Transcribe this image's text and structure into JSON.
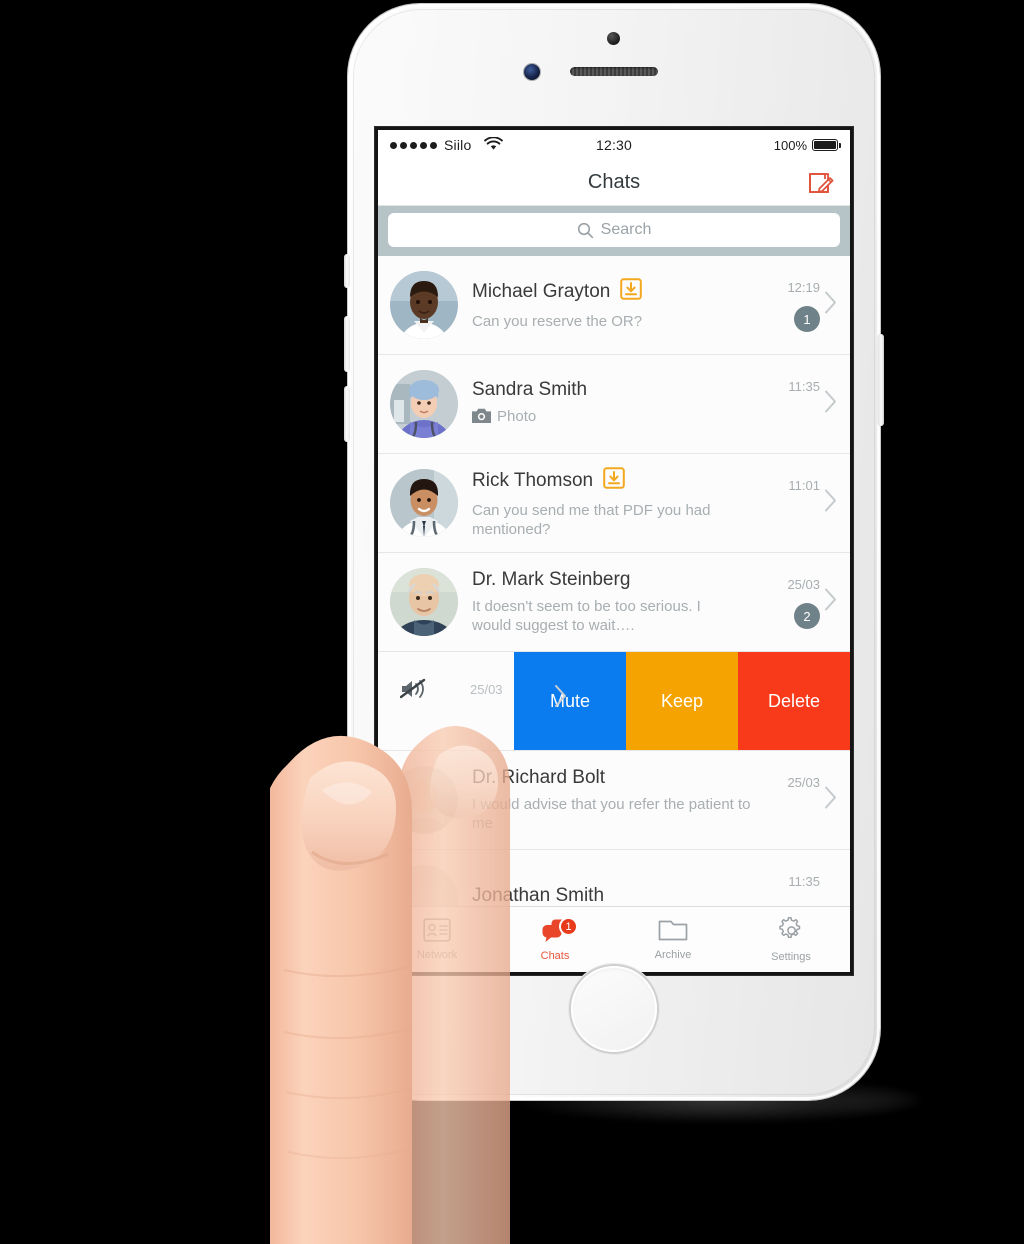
{
  "device": {
    "name": "white-smartphone",
    "hardware": [
      "front-camera",
      "earpiece-speaker",
      "proximity-sensor",
      "home-button",
      "power-button",
      "volume-buttons"
    ]
  },
  "status_bar": {
    "signal_dots": 5,
    "carrier": "Siilo",
    "wifi_icon": "wifi-icon",
    "time": "12:30",
    "battery_percent": "100%",
    "battery_level": 100
  },
  "nav_bar": {
    "title": "Chats",
    "compose_icon": "compose-pencil-icon",
    "compose_color": "#e0513a"
  },
  "search": {
    "placeholder": "Search",
    "icon": "search-icon",
    "bar_background": "#b6c3c7"
  },
  "chats": [
    {
      "name": "Michael Grayton",
      "message": "Can you reserve the OR?",
      "time": "12:19",
      "badge": "1",
      "download_icon": true,
      "attachment_icon": null,
      "muted": false,
      "avatar": "male-doctor-dark-skin"
    },
    {
      "name": "Sandra Smith",
      "message": "Photo",
      "time": "11:35",
      "badge": null,
      "download_icon": false,
      "attachment_icon": "camera-icon",
      "muted": false,
      "avatar": "female-nurse-scrub-cap"
    },
    {
      "name": "Rick Thomson",
      "message": "Can you send me that PDF you had mentioned?",
      "time": "11:01",
      "badge": null,
      "download_icon": true,
      "attachment_icon": null,
      "muted": false,
      "avatar": "male-doctor-tie-stethoscope"
    },
    {
      "name": "Dr. Mark Steinberg",
      "message": "It doesn't seem to be too serious. I would suggest to wait….",
      "time": "25/03",
      "badge": "2",
      "download_icon": false,
      "attachment_icon": null,
      "muted": false,
      "avatar": "elderly-male-doctor"
    }
  ],
  "swipe_row": {
    "mute_icon": "muted-speaker-icon",
    "date": "25/03",
    "actions": [
      {
        "label": "Mute",
        "color": "#0a7cf0"
      },
      {
        "label": "Keep",
        "color": "#f5a300"
      },
      {
        "label": "Delete",
        "color": "#f93a1a"
      }
    ]
  },
  "chats_below": [
    {
      "name": "Dr. Richard Bolt",
      "message": "I would advise that you refer the patient to me",
      "time": "25/03",
      "badge": null,
      "avatar": "male-doctor-partial"
    },
    {
      "name": "Jonathan Smith",
      "message": "",
      "time": "11:35",
      "badge": null,
      "avatar": "male-partial"
    }
  ],
  "tab_bar": {
    "items": [
      {
        "label": "Network",
        "icon": "contact-card-icon",
        "active": false,
        "badge": null
      },
      {
        "label": "Chats",
        "icon": "chat-bubbles-icon",
        "active": true,
        "badge": "1"
      },
      {
        "label": "Archive",
        "icon": "folder-icon",
        "active": false,
        "badge": null
      },
      {
        "label": "Settings",
        "icon": "gear-icon",
        "active": false,
        "badge": null
      }
    ],
    "active_color": "#e8563c",
    "inactive_color": "#9ba1a4"
  },
  "hand": {
    "description": "two-fingers-touching-screen",
    "skin_tone": "#f6c5ab"
  }
}
